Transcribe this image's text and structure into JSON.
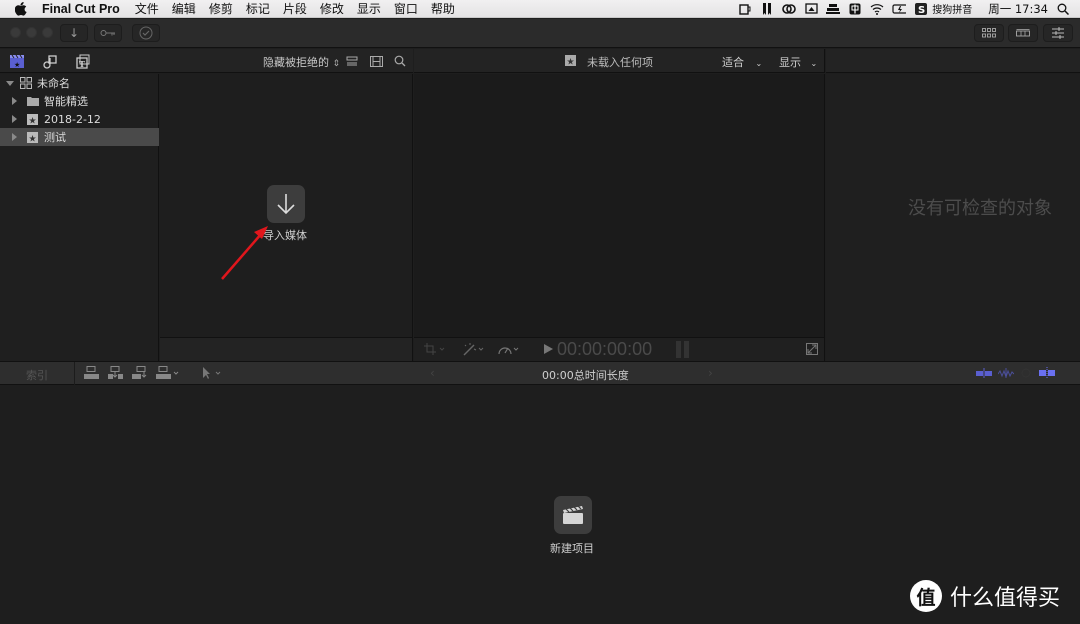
{
  "menubar": {
    "app_name": "Final Cut Pro",
    "items": [
      "文件",
      "编辑",
      "修剪",
      "标记",
      "片段",
      "修改",
      "显示",
      "窗口",
      "帮助"
    ],
    "input_method": "搜狗拼音",
    "clock": "周一 17:34"
  },
  "toolbar": {
    "import_icon": "↓",
    "keyword_icon": "key-icon",
    "background_tasks_icon": "check-circle-icon"
  },
  "browser": {
    "filter_label": "隐藏被拒绝的",
    "import_media_label": "导入媒体"
  },
  "library": {
    "name": "未命名",
    "items": [
      {
        "label": "智能精选",
        "icon": "folder-icon",
        "selected": false
      },
      {
        "label": "2018-2-12",
        "icon": "event-icon",
        "selected": false
      },
      {
        "label": "测试",
        "icon": "event-icon",
        "selected": true
      }
    ]
  },
  "viewer": {
    "status": "未载入任何项",
    "fit_label": "适合",
    "view_label": "显示",
    "timecode": "00:00:00:00"
  },
  "inspector": {
    "empty_message": "没有可检查的对象"
  },
  "timeline": {
    "index_label": "索引",
    "duration_label": "00:00总时间长度",
    "new_project_label": "新建项目",
    "accent_color": "#5a5fd0"
  },
  "watermark": {
    "badge": "值",
    "text": "什么值得买"
  },
  "annotation": {
    "arrow_color": "#e0161c"
  }
}
